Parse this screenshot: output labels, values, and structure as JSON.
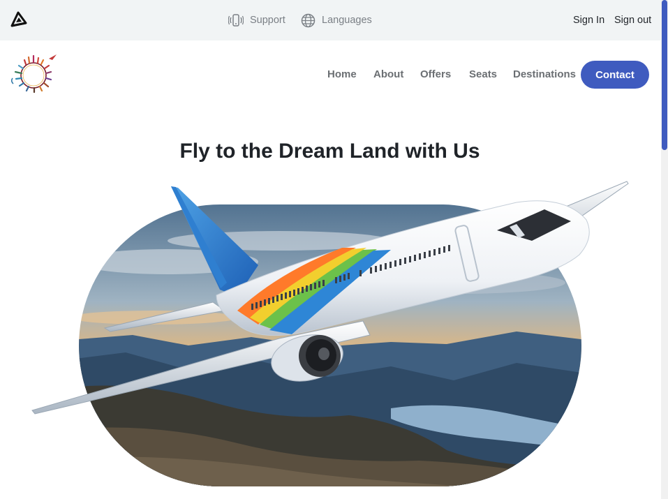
{
  "topbar": {
    "brand_icon": "triangle-logo-icon",
    "support": {
      "icon": "phone-vibrate-icon",
      "label": "Support"
    },
    "languages": {
      "icon": "globe-icon",
      "label": "Languages"
    },
    "sign_in": "Sign In",
    "sign_out": "Sign out"
  },
  "navbar": {
    "logo_icon": "world-landmarks-circle-logo",
    "links": [
      {
        "label": "Home"
      },
      {
        "label": "About"
      },
      {
        "label": "Offers"
      },
      {
        "label": "Seats"
      },
      {
        "label": "Destinations"
      }
    ],
    "contact_label": "Contact"
  },
  "hero": {
    "title": "Fly to the Dream Land with Us",
    "image": "airplane-over-mountains-illustration"
  },
  "colors": {
    "accent": "#3f5bbf",
    "topbar_bg": "#f1f4f5",
    "title_text": "#1f2328",
    "nav_text": "#6b6f73"
  }
}
